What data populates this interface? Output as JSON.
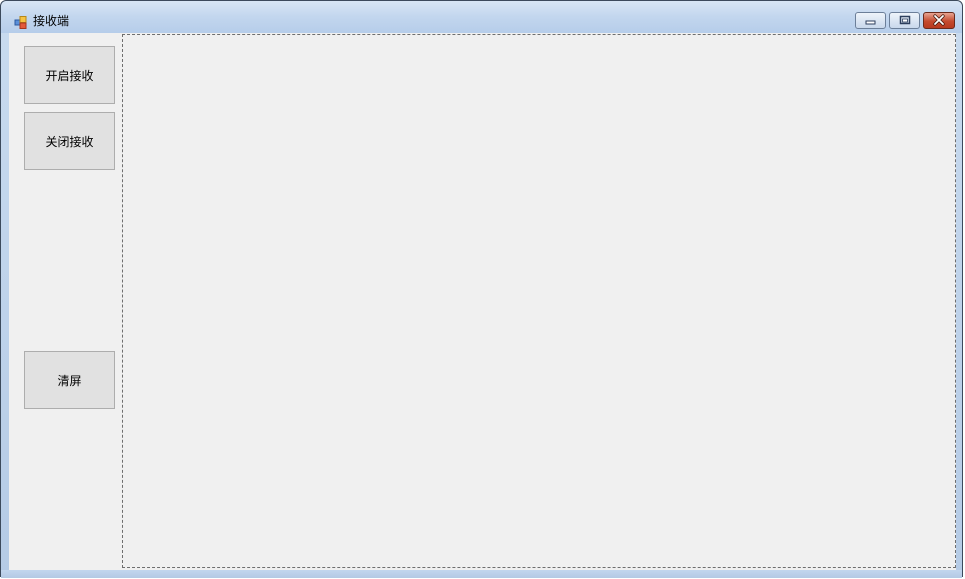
{
  "window": {
    "title": "接收端",
    "controls": {
      "minimize": "minimize-icon",
      "maximize": "maximize-icon",
      "close": "close-icon"
    }
  },
  "buttons": {
    "start_label": "开启接收",
    "stop_label": "关闭接收",
    "clear_label": "清屏"
  },
  "output": {
    "text": ""
  },
  "colors": {
    "titlebar": "#c2d6ee",
    "client": "#f0f0f0",
    "button": "#e1e1e1",
    "close_button": "#c44a2e"
  }
}
